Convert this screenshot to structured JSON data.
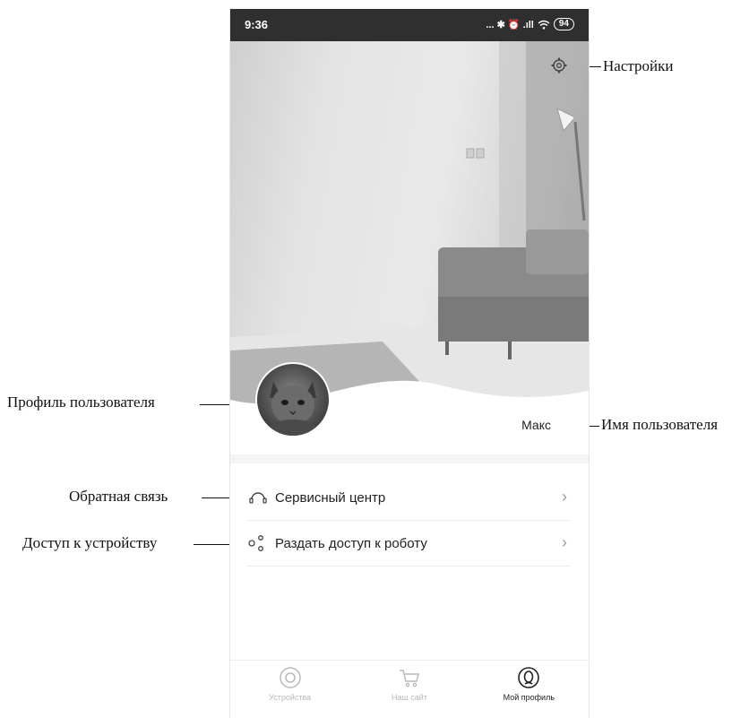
{
  "status_bar": {
    "time": "9:36",
    "icons": "... ✱ ⏰ .ıll",
    "battery": "94"
  },
  "profile": {
    "username": "Макс"
  },
  "menu": [
    {
      "label": "Сервисный центр",
      "icon": "headset-icon"
    },
    {
      "label": "Раздать доступ к роботу",
      "icon": "share-icon"
    }
  ],
  "tabs": [
    {
      "label": "Устройства",
      "icon": "robot-icon",
      "active": false
    },
    {
      "label": "Наш сайт",
      "icon": "cart-icon",
      "active": false
    },
    {
      "label": "Мой профиль",
      "icon": "profile-icon",
      "active": true
    }
  ],
  "annotations": {
    "settings": "Настройки",
    "user_profile": "Профиль пользователя",
    "user_name": "Имя пользователя",
    "feedback": "Обратная связь",
    "device_access": "Доступ к устройству"
  }
}
